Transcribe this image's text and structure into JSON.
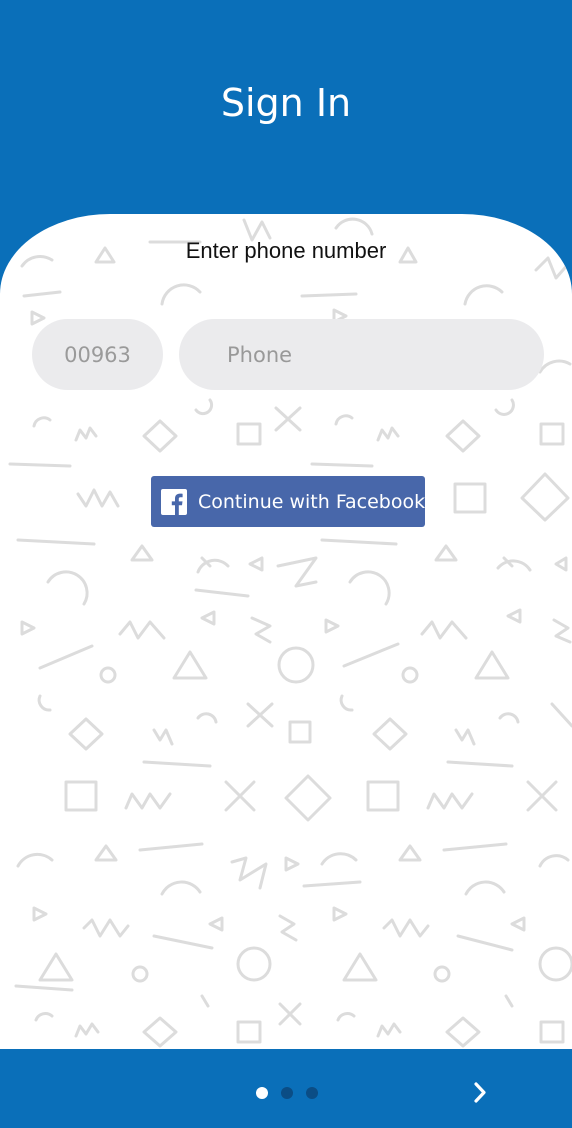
{
  "header": {
    "title": "Sign In"
  },
  "form": {
    "subtitle": "Enter phone number",
    "country_code": "00963",
    "phone_placeholder": "Phone",
    "phone_value": ""
  },
  "facebook_button": {
    "label": "Continue with Facebook",
    "icon": "facebook-f-icon"
  },
  "pager": {
    "current_page": 1,
    "total_pages": 3,
    "next_icon": "chevron-right-icon"
  },
  "colors": {
    "primary": "#0a6fb9",
    "facebook": "#4867aa",
    "field_background": "#ebebed",
    "pattern": "#dcdcdc",
    "dot_inactive": "#0b4d85"
  }
}
